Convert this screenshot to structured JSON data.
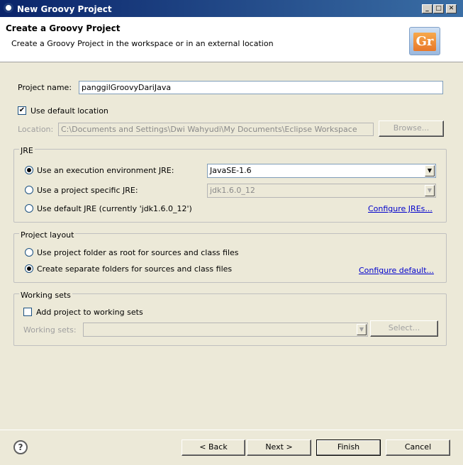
{
  "window": {
    "title": "New Groovy Project",
    "minimize_glyph": "_",
    "maximize_glyph": "□",
    "close_glyph": "✕"
  },
  "header": {
    "title": "Create a Groovy Project",
    "subtitle": "Create a Groovy Project in the workspace or in an external location",
    "logo_text": "Gr"
  },
  "project": {
    "name_label": "Project name:",
    "name_value": "panggilGroovyDariJava",
    "default_location_label": "Use default location",
    "default_location_checked": true,
    "location_label": "Location:",
    "location_value": "C:\\Documents and Settings\\Dwi Wahyudi\\My Documents\\Eclipse Workspace",
    "browse_label": "Browse..."
  },
  "jre": {
    "group_title": "JRE",
    "option_env_label": "Use an execution environment JRE:",
    "env_value": "JavaSE-1.6",
    "option_specific_label": "Use a project specific JRE:",
    "specific_value": "jdk1.6.0_12",
    "option_default_label": "Use default JRE (currently 'jdk1.6.0_12')",
    "configure_link": "Configure JREs...",
    "selected": "env"
  },
  "layout": {
    "group_title": "Project layout",
    "option_root_label": "Use project folder as root for sources and class files",
    "option_separate_label": "Create separate folders for sources and class files",
    "configure_link": "Configure default...",
    "selected": "separate"
  },
  "working_sets": {
    "group_title": "Working sets",
    "add_label": "Add project to working sets",
    "add_checked": false,
    "sets_label": "Working sets:",
    "sets_value": "",
    "select_label": "Select..."
  },
  "footer": {
    "help_glyph": "?",
    "back_label": "< Back",
    "next_label": "Next >",
    "finish_label": "Finish",
    "cancel_label": "Cancel"
  },
  "icons": {
    "dropdown_glyph": "▼",
    "check_glyph": "✔"
  }
}
